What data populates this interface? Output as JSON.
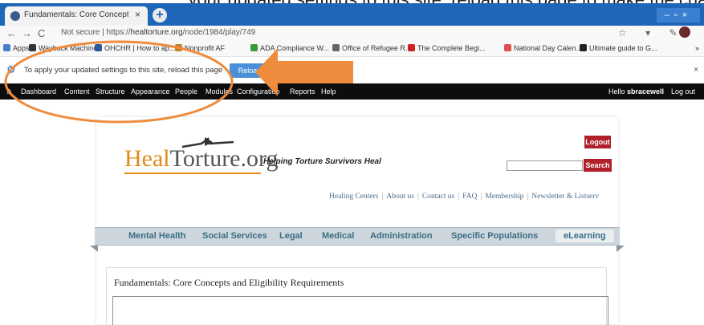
{
  "caption": {
    "text": "... your updated settings to this site, reload this page to make the changes you made take effect."
  },
  "browser": {
    "tab_title": "Fundamentals: Core Concepts ar",
    "tab_close": "×",
    "new_tab": "+",
    "window_controls": "–▫×",
    "nav": {
      "back": "←",
      "forward": "→",
      "refresh": "C"
    },
    "url_prefix": "Not secure | https://",
    "url_host": "healtorture.org",
    "url_path": "/node/1984/play/749",
    "addr_icons": "☆ ▾ ✎",
    "bookmarks": [
      {
        "label": "Apps",
        "color": "#4a7fd0"
      },
      {
        "label": "Wayback Machine",
        "color": "#333333"
      },
      {
        "label": "OHCHR | How to ap...",
        "color": "#2a5a9a"
      },
      {
        "label": "Nonprofit AF",
        "color": "#c08030"
      },
      {
        "label": "ADA Compliance W...",
        "color": "#3a9a3a"
      },
      {
        "label": "Office of Refugee R...",
        "color": "#666666"
      },
      {
        "label": "The Complete Begi...",
        "color": "#d02020"
      },
      {
        "label": "National Day Calen...",
        "color": "#e05050"
      },
      {
        "label": "Ultimate guide to G...",
        "color": "#222222"
      }
    ],
    "bookmarks_more": "»"
  },
  "notification": {
    "text": "To apply your updated settings to this site, reload this page",
    "reload_label": "Reload",
    "close": "×"
  },
  "admin_toolbar": {
    "home": "⌂",
    "items": [
      "Dashboard",
      "Content",
      "Structure",
      "Appearance",
      "People",
      "Modules",
      "Configuration",
      "Reports",
      "Help"
    ],
    "hello": "Hello",
    "username": "sbracewell",
    "logout": "Log out"
  },
  "site": {
    "logo_heal": "Heal",
    "logo_rest": "Torture.org",
    "tagline": "Helping Torture Survivors Heal",
    "logout_label": "Logout",
    "search_label": "Search",
    "search_value": "",
    "top_links": [
      "Healing Centers",
      "About us",
      "Contact us",
      "FAQ",
      "Membership",
      "Newsletter & Listserv"
    ],
    "main_nav": [
      "Mental Health",
      "Social Services",
      "Legal",
      "Medical",
      "Administration",
      "Specific Populations",
      "eLearning"
    ],
    "content_title": "Fundamentals: Core Concepts and Eligibility Requirements"
  },
  "annotation": {
    "ellipse_color": "#ef8b3c",
    "arrow_color": "#ef8b3c"
  }
}
